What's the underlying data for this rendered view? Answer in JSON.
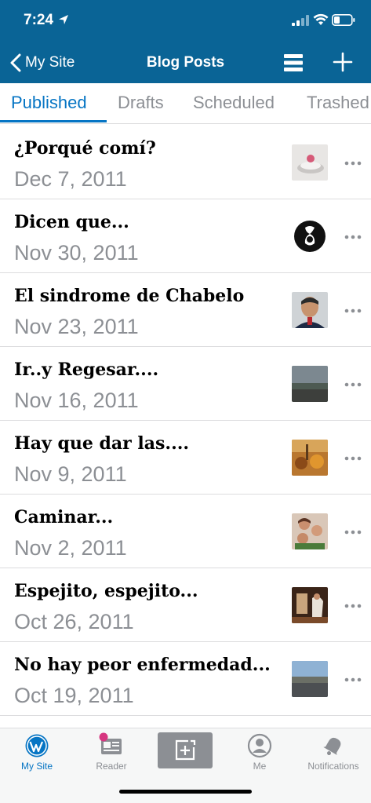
{
  "status": {
    "time": "7:24"
  },
  "nav": {
    "back_label": "My Site",
    "title": "Blog Posts"
  },
  "tabs": [
    {
      "label": "Published",
      "active": true
    },
    {
      "label": "Drafts",
      "active": false
    },
    {
      "label": "Scheduled",
      "active": false
    },
    {
      "label": "Trashed",
      "active": false
    }
  ],
  "posts": [
    {
      "title": "¿Porqué comí?",
      "date": "Dec 7, 2011"
    },
    {
      "title": "Dicen que...",
      "date": "Nov 30, 2011"
    },
    {
      "title": "El sindrome de Chabelo",
      "date": "Nov 23, 2011"
    },
    {
      "title": "Ir..y Regesar....",
      "date": "Nov 16, 2011"
    },
    {
      "title": "Hay que dar las....",
      "date": "Nov 9, 2011"
    },
    {
      "title": "Caminar...",
      "date": "Nov 2, 2011"
    },
    {
      "title": "Espejito, espejito...",
      "date": "Oct 26, 2011"
    },
    {
      "title": "No hay peor enfermedad...",
      "date": "Oct 19, 2011"
    }
  ],
  "bottom_nav": {
    "my_site": "My Site",
    "reader": "Reader",
    "me": "Me",
    "notifications": "Notifications"
  },
  "colors": {
    "brand": "#0a6496",
    "accent": "#0675c4",
    "muted": "#8c8f94",
    "badge": "#d63680"
  }
}
